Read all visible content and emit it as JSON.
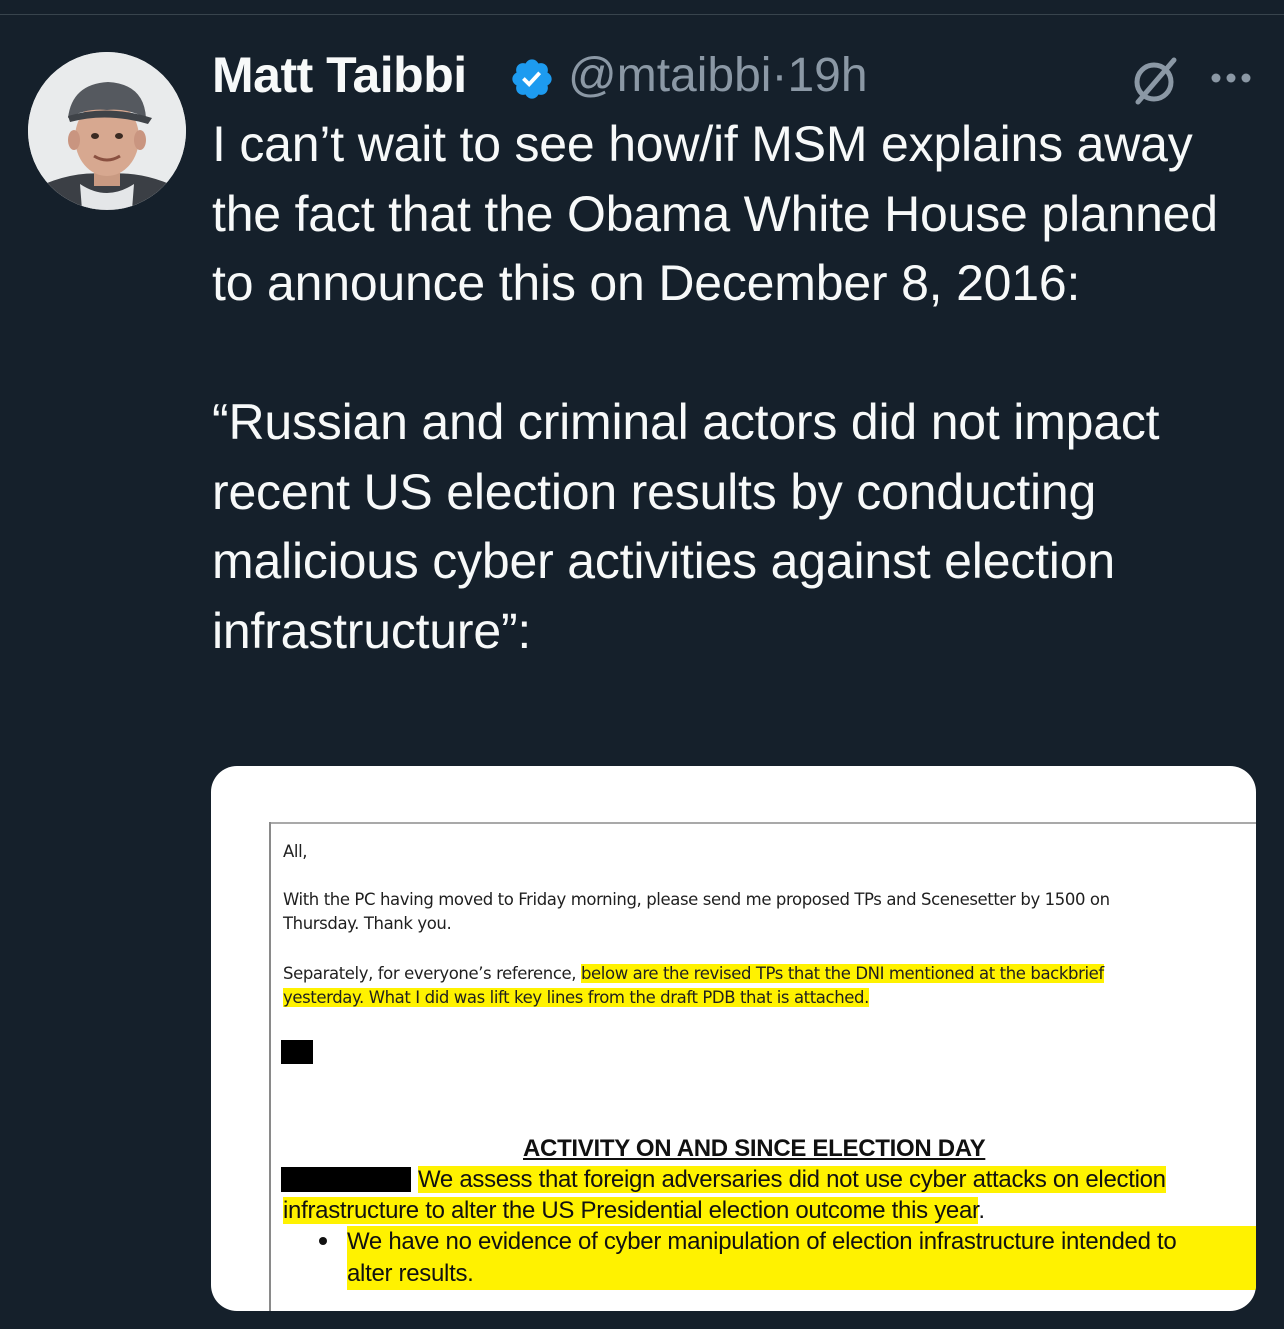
{
  "tweet": {
    "author": {
      "display_name": "Matt Taibbi",
      "handle": "@mtaibbi",
      "separator": "·",
      "timestamp": "19h",
      "verified": true
    },
    "text": "I can’t wait to see how/if MSM explains away the fact that the Obama White House planned to announce this on December 8, 2016:\n\n“Russian and criminal actors did not impact recent US election results by conducting malicious cyber activities against election infrastructure”:",
    "icons": {
      "avatar": "avatar-photo",
      "verified": "verified-badge-icon",
      "grok": "grok-icon",
      "more": "more-options-icon"
    },
    "colors": {
      "background": "#15202b",
      "text_primary": "#f7f9f9",
      "text_secondary": "#8b98a5",
      "verified_blue": "#1d9bf0",
      "highlight": "#fff200"
    }
  },
  "media": {
    "document": {
      "salutation": "All,",
      "paragraph1": "With the PC having moved to Friday morning, please send me proposed TPs and Scenesetter by 1500 on Thursday.  Thank you.",
      "paragraph2_plain": "Separately, for everyone’s reference, ",
      "paragraph2_highlight": "below are the revised TPs that the DNI mentioned at the backbrief yesterday.  What I did was lift key lines from the draft PDB that is attached.",
      "section_heading": "ACTIVITY ON AND SINCE ELECTION DAY",
      "assessment_line1": "We assess that foreign adversaries did not use cyber attacks on election",
      "assessment_line2": "infrastructure to alter the US Presidential election outcome this year",
      "assessment_period": ".",
      "bullet_line1": "We have no evidence of cyber manipulation of election infrastructure intended to",
      "bullet_line2": "alter results."
    }
  }
}
